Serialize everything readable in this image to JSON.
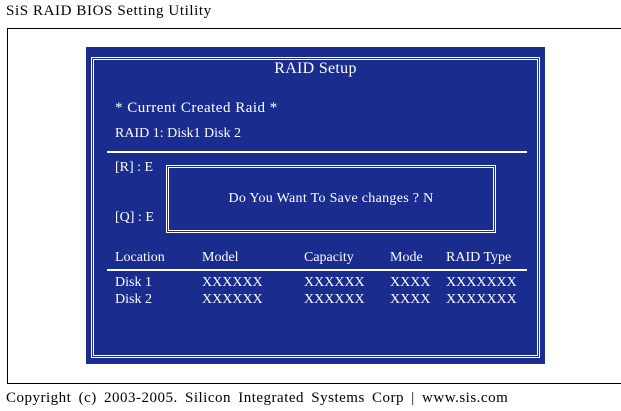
{
  "app": {
    "title": "SiS RAID BIOS Setting Utility"
  },
  "panel": {
    "title": "RAID Setup",
    "current_created_raid": "* Current Created Raid *",
    "raid1_line": "RAID 1: Disk1   Disk 2",
    "key_r": "[R] : E",
    "key_q": "[Q] : E"
  },
  "dialog": {
    "prompt": "Do You Want To Save changes ? N"
  },
  "table": {
    "columns": [
      "Location",
      "Model",
      "Capacity",
      "Mode",
      "RAID Type"
    ],
    "rows": [
      {
        "location": "Disk 1",
        "model": "XXXXXX",
        "capacity": "XXXXXX",
        "mode": "XXXX",
        "raid_type": "XXXXXXX"
      },
      {
        "location": "Disk 2",
        "model": "XXXXXX",
        "capacity": "XXXXXX",
        "mode": "XXXX",
        "raid_type": "XXXXXXX"
      }
    ]
  },
  "footer": {
    "copyright": "Copyright  (c)  2003-2005.  Silicon  Integrated  Systems  Corp    |    www.sis.com"
  },
  "colors": {
    "panel_bg": "#1b2c8f",
    "text_on_panel": "#ffffff",
    "page_bg": "#ffffff"
  }
}
